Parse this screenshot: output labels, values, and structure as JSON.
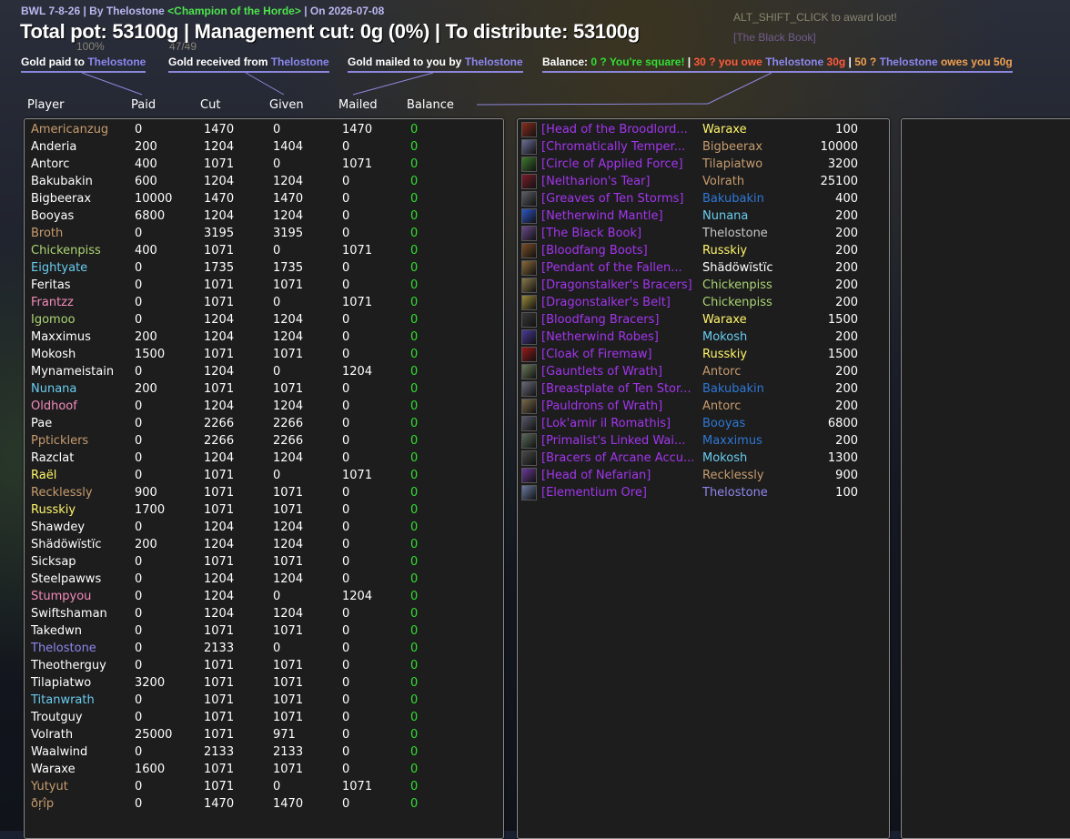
{
  "colors": {
    "bg": "#1b2030",
    "panel": "#1d1d1d",
    "balance_zero": "#33dd33",
    "epic": "#a335ee",
    "link": "#8c87ee"
  },
  "ghost": {
    "award_hint": "ALT_SHIFT_CLICK to award loot!",
    "black_book": "[The Black Book]",
    "pct": "100%",
    "num": "47/49"
  },
  "header": {
    "subtitle_prefix": "BWL 7-8-26 | By Thelostone ",
    "subtitle_title": "<Champion of the Horde>",
    "subtitle_suffix": " | On 2026-07-08",
    "title": "Total pot: 53100g | Management cut: 0g (0%) | To distribute: 53100g"
  },
  "legends": {
    "paid": {
      "text": "Gold paid to ",
      "name": "Thelostone"
    },
    "received": {
      "text": "Gold received from ",
      "name": "Thelostone"
    },
    "mailed": {
      "text": "Gold mailed to you by ",
      "name": "Thelostone"
    },
    "balance": {
      "label": "Balance: ",
      "square": "0 ? You're square!",
      "sep1": " | ",
      "owe_prefix": "30 ? you owe ",
      "owe_name": "Thelostone",
      "owe_amount": " 30g",
      "sep2": " | ",
      "owed_prefix": "50 ? ",
      "owed_name": "Thelostone",
      "owed_suffix": " owes you 50g"
    }
  },
  "columns": {
    "player": "Player",
    "paid": "Paid",
    "cut": "Cut",
    "given": "Given",
    "mailed": "Mailed",
    "balance": "Balance"
  },
  "players": [
    {
      "name": "Americanzug",
      "color": "#c79c6e",
      "paid": "0",
      "cut": "1470",
      "given": "0",
      "mailed": "1470",
      "balance": "0"
    },
    {
      "name": "Anderia",
      "color": "#ffffff",
      "paid": "200",
      "cut": "1204",
      "given": "1404",
      "mailed": "0",
      "balance": "0"
    },
    {
      "name": "Antorc",
      "color": "#ffffff",
      "paid": "400",
      "cut": "1071",
      "given": "0",
      "mailed": "1071",
      "balance": "0"
    },
    {
      "name": "Bakubakin",
      "color": "#ffffff",
      "paid": "600",
      "cut": "1204",
      "given": "1204",
      "mailed": "0",
      "balance": "0"
    },
    {
      "name": "Bigbeerax",
      "color": "#ffffff",
      "paid": "10000",
      "cut": "1470",
      "given": "1470",
      "mailed": "0",
      "balance": "0"
    },
    {
      "name": "Booyas",
      "color": "#ffffff",
      "paid": "6800",
      "cut": "1204",
      "given": "1204",
      "mailed": "0",
      "balance": "0"
    },
    {
      "name": "Broth",
      "color": "#c79c6e",
      "paid": "0",
      "cut": "3195",
      "given": "3195",
      "mailed": "0",
      "balance": "0"
    },
    {
      "name": "Chickenpiss",
      "color": "#abd473",
      "paid": "400",
      "cut": "1071",
      "given": "0",
      "mailed": "1071",
      "balance": "0"
    },
    {
      "name": "Eightyate",
      "color": "#69ccf0",
      "paid": "0",
      "cut": "1735",
      "given": "1735",
      "mailed": "0",
      "balance": "0"
    },
    {
      "name": "Feritas",
      "color": "#ffffff",
      "paid": "0",
      "cut": "1071",
      "given": "1071",
      "mailed": "0",
      "balance": "0"
    },
    {
      "name": "Frantzz",
      "color": "#f58cba",
      "paid": "0",
      "cut": "1071",
      "given": "0",
      "mailed": "1071",
      "balance": "0"
    },
    {
      "name": "Igomoo",
      "color": "#abd473",
      "paid": "0",
      "cut": "1204",
      "given": "1204",
      "mailed": "0",
      "balance": "0"
    },
    {
      "name": "Maxximus",
      "color": "#ffffff",
      "paid": "200",
      "cut": "1204",
      "given": "1204",
      "mailed": "0",
      "balance": "0"
    },
    {
      "name": "Mokosh",
      "color": "#ffffff",
      "paid": "1500",
      "cut": "1071",
      "given": "1071",
      "mailed": "0",
      "balance": "0"
    },
    {
      "name": "Mynameistain",
      "color": "#ffffff",
      "paid": "0",
      "cut": "1204",
      "given": "0",
      "mailed": "1204",
      "balance": "0"
    },
    {
      "name": "Nunana",
      "color": "#69ccf0",
      "paid": "200",
      "cut": "1071",
      "given": "1071",
      "mailed": "0",
      "balance": "0"
    },
    {
      "name": "Oldhoof",
      "color": "#f58cba",
      "paid": "0",
      "cut": "1204",
      "given": "1204",
      "mailed": "0",
      "balance": "0"
    },
    {
      "name": "Pae",
      "color": "#ffffff",
      "paid": "0",
      "cut": "2266",
      "given": "2266",
      "mailed": "0",
      "balance": "0"
    },
    {
      "name": "Ppticklers",
      "color": "#c79c6e",
      "paid": "0",
      "cut": "2266",
      "given": "2266",
      "mailed": "0",
      "balance": "0"
    },
    {
      "name": "Razclat",
      "color": "#ffffff",
      "paid": "0",
      "cut": "1204",
      "given": "1204",
      "mailed": "0",
      "balance": "0"
    },
    {
      "name": "Raël",
      "color": "#fff569",
      "paid": "0",
      "cut": "1071",
      "given": "0",
      "mailed": "1071",
      "balance": "0"
    },
    {
      "name": "Recklessly",
      "color": "#c79c6e",
      "paid": "900",
      "cut": "1071",
      "given": "1071",
      "mailed": "0",
      "balance": "0"
    },
    {
      "name": "Russkiy",
      "color": "#fff569",
      "paid": "1700",
      "cut": "1071",
      "given": "1071",
      "mailed": "0",
      "balance": "0"
    },
    {
      "name": "Shawdey",
      "color": "#ffffff",
      "paid": "0",
      "cut": "1204",
      "given": "1204",
      "mailed": "0",
      "balance": "0"
    },
    {
      "name": "Shädöwïstïc",
      "color": "#ffffff",
      "paid": "200",
      "cut": "1204",
      "given": "1204",
      "mailed": "0",
      "balance": "0"
    },
    {
      "name": "Sicksap",
      "color": "#ffffff",
      "paid": "0",
      "cut": "1071",
      "given": "1071",
      "mailed": "0",
      "balance": "0"
    },
    {
      "name": "Steelpawws",
      "color": "#ffffff",
      "paid": "0",
      "cut": "1204",
      "given": "1204",
      "mailed": "0",
      "balance": "0"
    },
    {
      "name": "Stumpyou",
      "color": "#f58cba",
      "paid": "0",
      "cut": "1204",
      "given": "0",
      "mailed": "1204",
      "balance": "0"
    },
    {
      "name": "Swiftshaman",
      "color": "#ffffff",
      "paid": "0",
      "cut": "1204",
      "given": "1204",
      "mailed": "0",
      "balance": "0"
    },
    {
      "name": "Takedwn",
      "color": "#ffffff",
      "paid": "0",
      "cut": "1071",
      "given": "1071",
      "mailed": "0",
      "balance": "0"
    },
    {
      "name": "Thelostone",
      "color": "#8c87ee",
      "paid": "0",
      "cut": "2133",
      "given": "0",
      "mailed": "0",
      "balance": "0"
    },
    {
      "name": "Theotherguy",
      "color": "#ffffff",
      "paid": "0",
      "cut": "1071",
      "given": "1071",
      "mailed": "0",
      "balance": "0"
    },
    {
      "name": "Tilapiatwo",
      "color": "#ffffff",
      "paid": "3200",
      "cut": "1071",
      "given": "1071",
      "mailed": "0",
      "balance": "0"
    },
    {
      "name": "Titanwrath",
      "color": "#69ccf0",
      "paid": "0",
      "cut": "1071",
      "given": "1071",
      "mailed": "0",
      "balance": "0"
    },
    {
      "name": "Troutguy",
      "color": "#ffffff",
      "paid": "0",
      "cut": "1071",
      "given": "1071",
      "mailed": "0",
      "balance": "0"
    },
    {
      "name": "Volrath",
      "color": "#ffffff",
      "paid": "25000",
      "cut": "1071",
      "given": "971",
      "mailed": "0",
      "balance": "0"
    },
    {
      "name": "Waalwind",
      "color": "#ffffff",
      "paid": "0",
      "cut": "2133",
      "given": "2133",
      "mailed": "0",
      "balance": "0"
    },
    {
      "name": "Waraxe",
      "color": "#ffffff",
      "paid": "1600",
      "cut": "1071",
      "given": "1071",
      "mailed": "0",
      "balance": "0"
    },
    {
      "name": "Yutyut",
      "color": "#c79c6e",
      "paid": "0",
      "cut": "1071",
      "given": "0",
      "mailed": "1071",
      "balance": "0"
    },
    {
      "name": "ðŗîp",
      "color": "#c79c6e",
      "paid": "0",
      "cut": "1470",
      "given": "1470",
      "mailed": "0",
      "balance": "0"
    }
  ],
  "items": [
    {
      "name": "[Head of the Broodlord...",
      "winner": "Waraxe",
      "winner_color": "#fff569",
      "price": "100",
      "icon": "dragon-head-icon",
      "icon_color": "#8b2c1c"
    },
    {
      "name": "[Chromatically Temper...",
      "winner": "Bigbeerax",
      "winner_color": "#c79c6e",
      "price": "10000",
      "icon": "shield-icon",
      "icon_color": "#6d6f99"
    },
    {
      "name": "[Circle of Applied Force]",
      "winner": "Tilapiatwo",
      "winner_color": "#c79c6e",
      "price": "3200",
      "icon": "ring-icon",
      "icon_color": "#3d7a2e"
    },
    {
      "name": "[Neltharion's Tear]",
      "winner": "Volrath",
      "winner_color": "#c79c6e",
      "price": "25100",
      "icon": "trinket-icon",
      "icon_color": "#7a1e2a"
    },
    {
      "name": "[Greaves of Ten Storms]",
      "winner": "Bakubakin",
      "winner_color": "#2e78d6",
      "price": "400",
      "icon": "boots-icon",
      "icon_color": "#5c5f66"
    },
    {
      "name": "[Netherwind Mantle]",
      "winner": "Nunana",
      "winner_color": "#69ccf0",
      "price": "200",
      "icon": "shoulder-icon",
      "icon_color": "#2e56c8"
    },
    {
      "name": "[The Black Book]",
      "winner": "Thelostone",
      "winner_color": "#c7c7c7",
      "price": "200",
      "icon": "book-icon",
      "icon_color": "#6b4a8a"
    },
    {
      "name": "[Bloodfang Boots]",
      "winner": "Russkiy",
      "winner_color": "#fff569",
      "price": "200",
      "icon": "boots-icon",
      "icon_color": "#7a4e26"
    },
    {
      "name": "[Pendant of the Fallen...",
      "winner": "Shädöwïstïc",
      "winner_color": "#ffffff",
      "price": "200",
      "icon": "amulet-icon",
      "icon_color": "#8a6a3a"
    },
    {
      "name": "[Dragonstalker's Bracers]",
      "winner": "Chickenpiss",
      "winner_color": "#abd473",
      "price": "200",
      "icon": "bracer-icon",
      "icon_color": "#8a7a4a"
    },
    {
      "name": "[Dragonstalker's Belt]",
      "winner": "Chickenpiss",
      "winner_color": "#abd473",
      "price": "200",
      "icon": "belt-icon",
      "icon_color": "#9a8a3a"
    },
    {
      "name": "[Bloodfang Bracers]",
      "winner": "Waraxe",
      "winner_color": "#fff569",
      "price": "1500",
      "icon": "bracer-icon",
      "icon_color": "#3a3a3a"
    },
    {
      "name": "[Netherwind Robes]",
      "winner": "Mokosh",
      "winner_color": "#69ccf0",
      "price": "200",
      "icon": "robe-icon",
      "icon_color": "#4a3a9a"
    },
    {
      "name": "[Cloak of Firemaw]",
      "winner": "Russkiy",
      "winner_color": "#fff569",
      "price": "1500",
      "icon": "cloak-icon",
      "icon_color": "#9a1a1a"
    },
    {
      "name": "[Gauntlets of Wrath]",
      "winner": "Antorc",
      "winner_color": "#c79c6e",
      "price": "200",
      "icon": "gauntlet-icon",
      "icon_color": "#6a7a5a"
    },
    {
      "name": "[Breastplate of Ten Stor...",
      "winner": "Bakubakin",
      "winner_color": "#2e78d6",
      "price": "200",
      "icon": "chest-icon",
      "icon_color": "#6a6a7a"
    },
    {
      "name": "[Pauldrons of Wrath]",
      "winner": "Antorc",
      "winner_color": "#c79c6e",
      "price": "200",
      "icon": "shoulder-icon",
      "icon_color": "#7a6a4a"
    },
    {
      "name": "[Lok'amir il Romathis]",
      "winner": "Booyas",
      "winner_color": "#2e78d6",
      "price": "6800",
      "icon": "mace-icon",
      "icon_color": "#5a5a6a"
    },
    {
      "name": "[Primalist's Linked Wai...",
      "winner": "Maxximus",
      "winner_color": "#2e78d6",
      "price": "200",
      "icon": "belt-icon",
      "icon_color": "#5a6a5a"
    },
    {
      "name": "[Bracers of Arcane Accu...",
      "winner": "Mokosh",
      "winner_color": "#69ccf0",
      "price": "1300",
      "icon": "bracer-icon",
      "icon_color": "#4a4a4a"
    },
    {
      "name": "[Head of Nefarian]",
      "winner": "Recklessly",
      "winner_color": "#c79c6e",
      "price": "900",
      "icon": "dragon-head-icon",
      "icon_color": "#6a3a9a"
    },
    {
      "name": "[Elementium Ore]",
      "winner": "Thelostone",
      "winner_color": "#8c87ee",
      "price": "100",
      "icon": "ore-icon",
      "icon_color": "#6a7aa0"
    }
  ]
}
